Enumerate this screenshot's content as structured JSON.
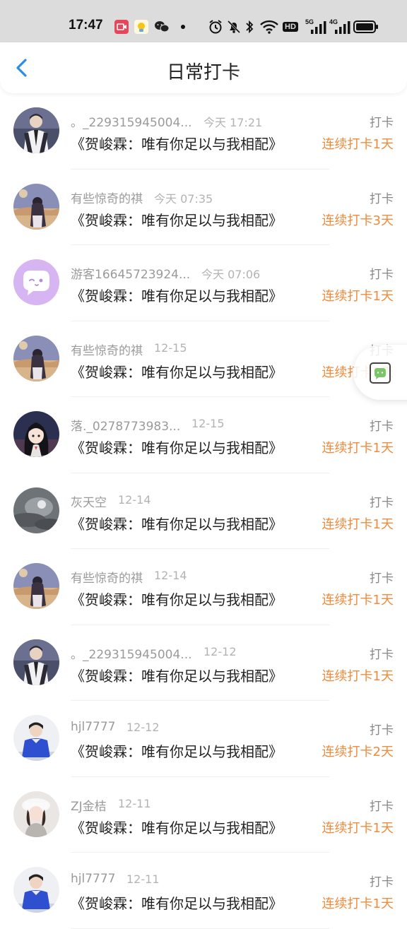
{
  "status_bar": {
    "time": "17:47",
    "icons": [
      "screen-record-icon",
      "app-notification-icon",
      "wechat-icon",
      "dot-icon",
      "alarm-icon",
      "mute-icon",
      "bluetooth-icon",
      "wifi-icon",
      "hd-icon",
      "signal-5g-icon",
      "signal-4g-icon",
      "battery-icon"
    ],
    "hd_label": "HD",
    "net_5g": "5G",
    "net_4g": "4G"
  },
  "header": {
    "title": "日常打卡",
    "accent_color": "#2a8ee8"
  },
  "checkins": [
    {
      "user": "。_229315945004...",
      "time": "今天 17:21",
      "book": "《贺峻霖：唯有你足以与我相配》",
      "label": "打卡",
      "streak": "连续打卡1天",
      "avatar": "portrait-boy-suit-avatar"
    },
    {
      "user": "有些惊奇的祺",
      "time": "今天 07:35",
      "book": "《贺峻霖：唯有你足以与我相配》",
      "label": "打卡",
      "streak": "连续打卡3天",
      "avatar": "anime-girl-sky-avatar"
    },
    {
      "user": "游客16645723924...",
      "time": "今天 07:06",
      "book": "《贺峻霖：唯有你足以与我相配》",
      "label": "打卡",
      "streak": "连续打卡1天",
      "avatar": "chat-bubble-avatar"
    },
    {
      "user": "有些惊奇的祺",
      "time": "12-15",
      "book": "《贺峻霖：唯有你足以与我相配》",
      "label": "打卡",
      "streak": "连续打卡1天",
      "avatar": "anime-girl-sky-avatar"
    },
    {
      "user": "落._0278773983...",
      "time": "12-15",
      "book": "《贺峻霖：唯有你足以与我相配》",
      "label": "打卡",
      "streak": "连续打卡1天",
      "avatar": "cartoon-girl-avatar"
    },
    {
      "user": "灰天空",
      "time": "12-14",
      "book": "《贺峻霖：唯有你足以与我相配》",
      "label": "打卡",
      "streak": "连续打卡1天",
      "avatar": "grey-sky-avatar"
    },
    {
      "user": "有些惊奇的祺",
      "time": "12-14",
      "book": "《贺峻霖：唯有你足以与我相配》",
      "label": "打卡",
      "streak": "连续打卡1天",
      "avatar": "anime-girl-sky-avatar"
    },
    {
      "user": "。_229315945004...",
      "time": "12-12",
      "book": "《贺峻霖：唯有你足以与我相配》",
      "label": "打卡",
      "streak": "连续打卡1天",
      "avatar": "portrait-boy-suit-avatar"
    },
    {
      "user": "hjl7777",
      "time": "12-12",
      "book": "《贺峻霖：唯有你足以与我相配》",
      "label": "打卡",
      "streak": "连续打卡2天",
      "avatar": "boy-blue-shirt-avatar"
    },
    {
      "user": "ZJ金桔",
      "time": "12-11",
      "book": "《贺峻霖：唯有你足以与我相配》",
      "label": "打卡",
      "streak": "连续打卡1天",
      "avatar": "girl-white-hat-avatar"
    },
    {
      "user": "hjl7777",
      "time": "12-11",
      "book": "《贺峻霖：唯有你足以与我相配》",
      "label": "打卡",
      "streak": "连续打卡1天",
      "avatar": "boy-blue-shirt-avatar"
    }
  ],
  "float_button": {
    "icon": "chat-float-icon",
    "color": "#7ac46a"
  }
}
